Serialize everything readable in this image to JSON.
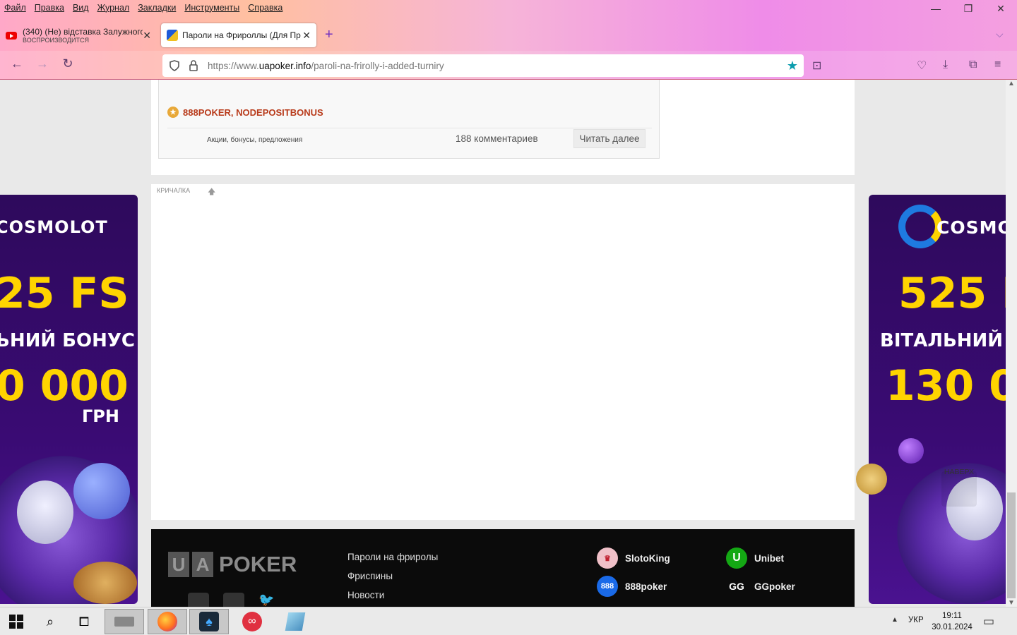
{
  "browser": {
    "menu": [
      "Файл",
      "Правка",
      "Вид",
      "Журнал",
      "Закладки",
      "Инструменты",
      "Справка"
    ],
    "tabs": [
      {
        "title": "(340) (Не) відставка Залужного",
        "subtitle": "ВОСПРОИЗВОДИТСЯ"
      },
      {
        "title": "Пароли на Фрироллы (Для Пр"
      }
    ],
    "url": {
      "prefix": "https://www.",
      "host": "uapoker.info",
      "path": "/paroli-na-frirolly-i-added-turniry"
    },
    "icons": {
      "back": "arrow-left-icon",
      "forward": "arrow-right-icon",
      "reload": "reload-icon",
      "shield": "shield-icon",
      "lock": "lock-icon",
      "bookmark": "star-icon",
      "pocket": "pocket-icon",
      "download": "download-icon",
      "extensions": "puzzle-icon",
      "menu": "hamburger-icon"
    },
    "accent": "#7030c0"
  },
  "post": {
    "tags": "888POKER, NODEPOSITBONUS",
    "category": "Акции, бонусы, предложения",
    "comments": "188 комментариев",
    "read_more": "Читать далее"
  },
  "shoutbox": {
    "label": "КРИЧАЛКА"
  },
  "bannerLeft": {
    "brand": "COSMOLOT",
    "big": "25 FS",
    "mid": "ЬНИЙ БОНУС",
    "amount": "0 000",
    "currency": "ГРН"
  },
  "bannerRight": {
    "brand": "COSMO",
    "big": "525 F",
    "mid": "ВІТАЛЬНИЙ Б",
    "amount": "130 0"
  },
  "footer": {
    "logo": {
      "u": "U",
      "a": "A",
      "text": "POKER"
    },
    "links": [
      "Пароли на фриролы",
      "Фриспины",
      "Новости"
    ],
    "rooms": [
      "SlotoKing",
      "Unibet",
      "888poker",
      "GGpoker"
    ]
  },
  "to_top": "НАВЕРХ",
  "taskbar": {
    "lang": "УКР",
    "time": "19:11",
    "date": "30.01.2024"
  }
}
